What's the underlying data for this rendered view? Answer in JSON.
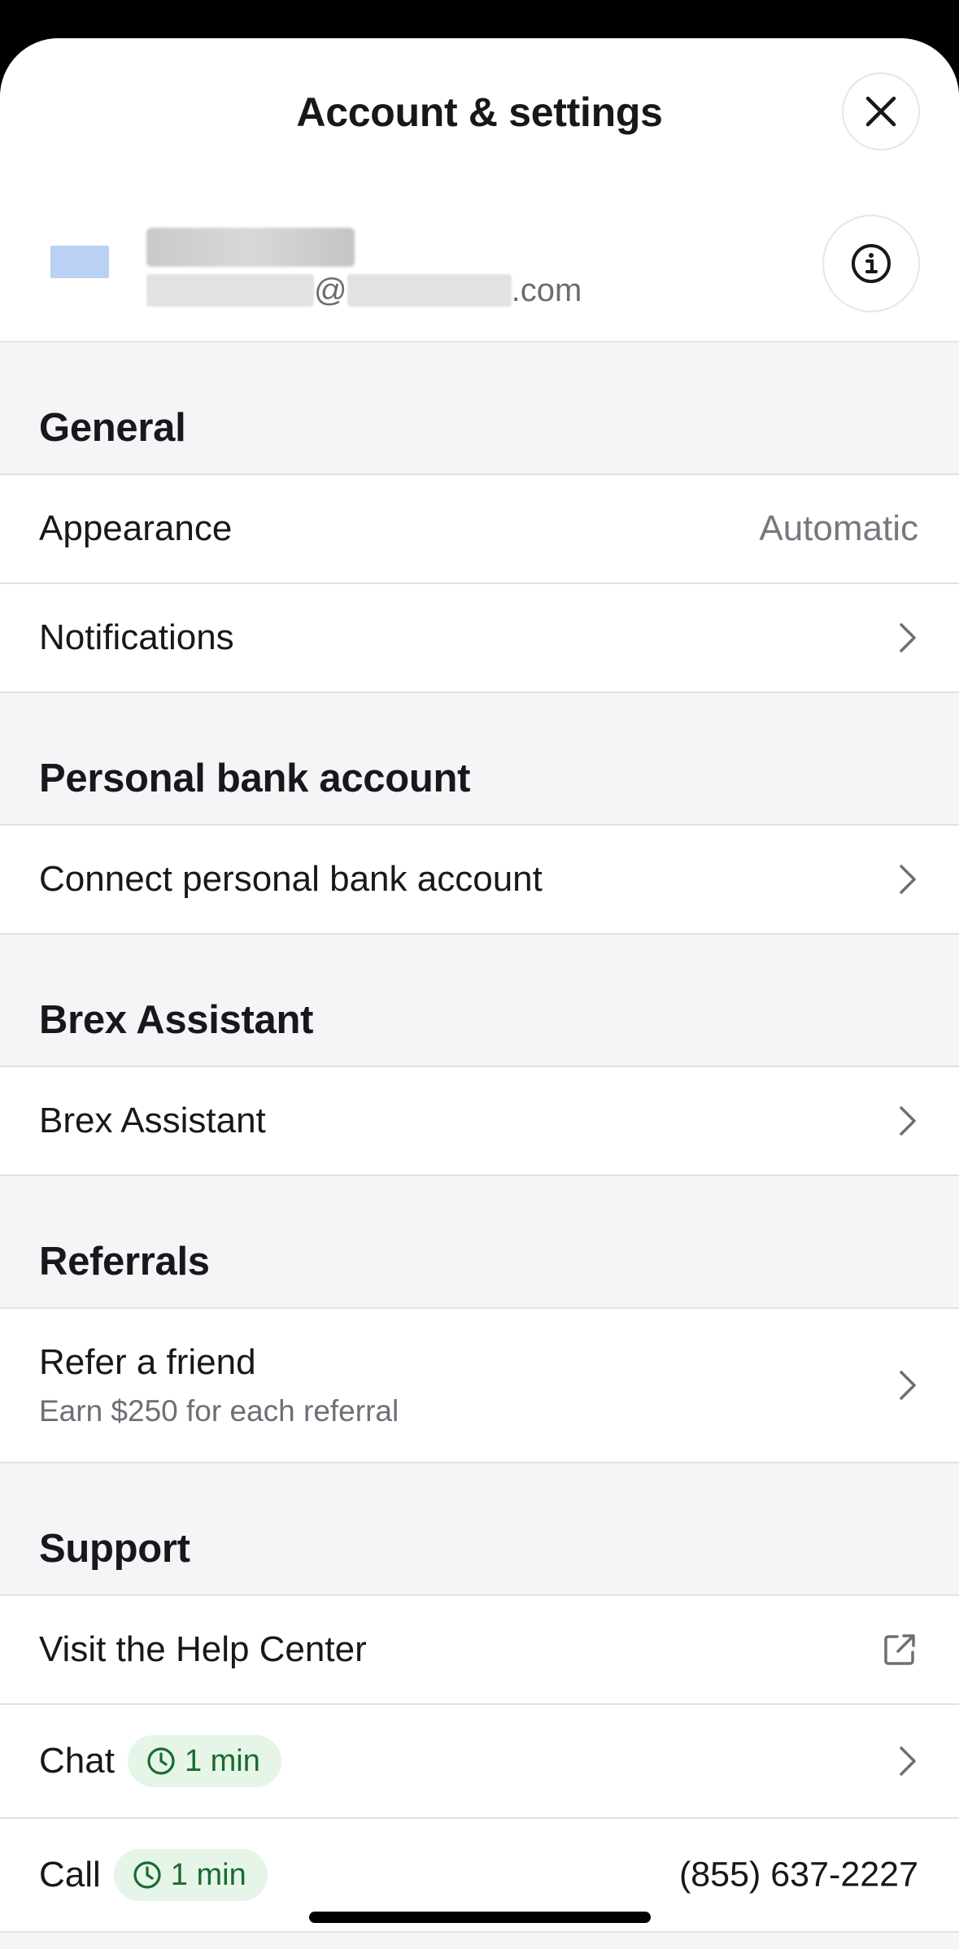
{
  "header": {
    "title": "Account & settings"
  },
  "profile": {
    "email_at": "@",
    "email_domain": ".com"
  },
  "sections": {
    "general": {
      "title": "General",
      "appearance": {
        "label": "Appearance",
        "value": "Automatic"
      },
      "notifications": {
        "label": "Notifications"
      }
    },
    "bank": {
      "title": "Personal bank account",
      "connect": {
        "label": "Connect personal bank account"
      }
    },
    "assistant": {
      "title": "Brex Assistant",
      "item": {
        "label": "Brex Assistant"
      }
    },
    "referrals": {
      "title": "Referrals",
      "refer": {
        "label": "Refer a friend",
        "sub": "Earn $250 for each referral"
      }
    },
    "support": {
      "title": "Support",
      "help": {
        "label": "Visit the Help Center"
      },
      "chat": {
        "label": "Chat",
        "wait": "1 min"
      },
      "call": {
        "label": "Call",
        "wait": "1 min",
        "phone": "(855) 637-2227"
      }
    }
  },
  "colors": {
    "chip_bg": "#e5f5e8",
    "chip_text": "#1a6b30",
    "avatar": "#b9d1f2"
  },
  "icons": [
    "close-icon",
    "info-icon",
    "chevron-right-icon",
    "external-link-icon",
    "clock-icon"
  ]
}
